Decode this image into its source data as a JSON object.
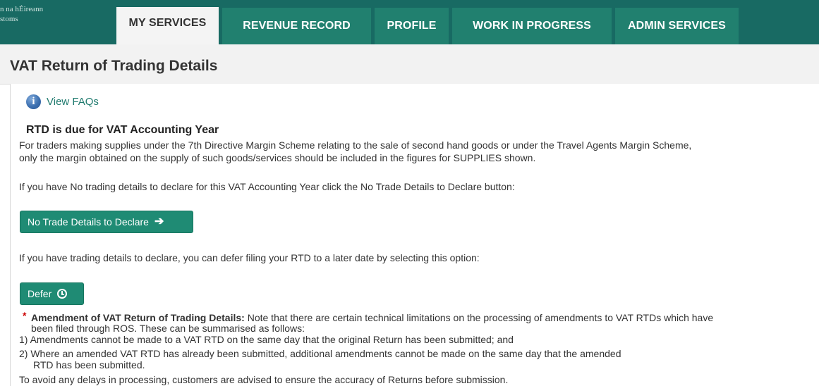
{
  "nav": {
    "brand_line1": "n na hÉireann",
    "brand_line2": "stoms",
    "tabs": [
      {
        "label": "MY SERVICES"
      },
      {
        "label": "REVENUE RECORD"
      },
      {
        "label": "PROFILE"
      },
      {
        "label": "WORK IN PROGRESS"
      },
      {
        "label": "ADMIN SERVICES"
      }
    ]
  },
  "page": {
    "title": "VAT Return of Trading Details",
    "faq_link": "View FAQs",
    "heading": "RTD is due for VAT Accounting Year",
    "intro_line1": "For traders making supplies under the 7th Directive Margin Scheme relating to the sale of second hand goods or under the Travel Agents Margin Scheme,",
    "intro_line2": "only the margin obtained on the supply of such goods/services should be included in the figures for SUPPLIES shown.",
    "no_trade_text": "If you have No trading details to declare for this VAT Accounting Year click the No Trade Details to Declare button:",
    "no_trade_button": "No Trade Details to Declare",
    "defer_text": "If you have trading details to declare, you can defer filing your RTD to a later date by selecting this option:",
    "defer_button": "Defer",
    "amendment_title": "Amendment of VAT Return of Trading Details:",
    "amendment_text1": " Note that there are certain technical limitations on the processing of amendments to VAT RTDs which have",
    "amendment_text2": "been filed through ROS. These can be summarised as follows:",
    "amendment_item1": "1)  Amendments cannot be made to a VAT RTD on the same day that the original Return has been submitted; and",
    "amendment_item2_line1": "2)  Where an amended VAT RTD has already been submitted, additional amendments cannot be made on the same day that the amended",
    "amendment_item2_line2": "RTD has been submitted.",
    "closing_text": "To avoid any delays in processing, customers are advised to ensure the accuracy of Returns before submission."
  },
  "colors": {
    "nav_bg": "#186a63",
    "tab_bg": "#21806f",
    "button_bg": "#1f8b74",
    "link": "#1f7a6e"
  },
  "icons": {
    "faq": "info-icon",
    "no_trade": "arrow-right-icon",
    "defer": "clock-icon"
  }
}
